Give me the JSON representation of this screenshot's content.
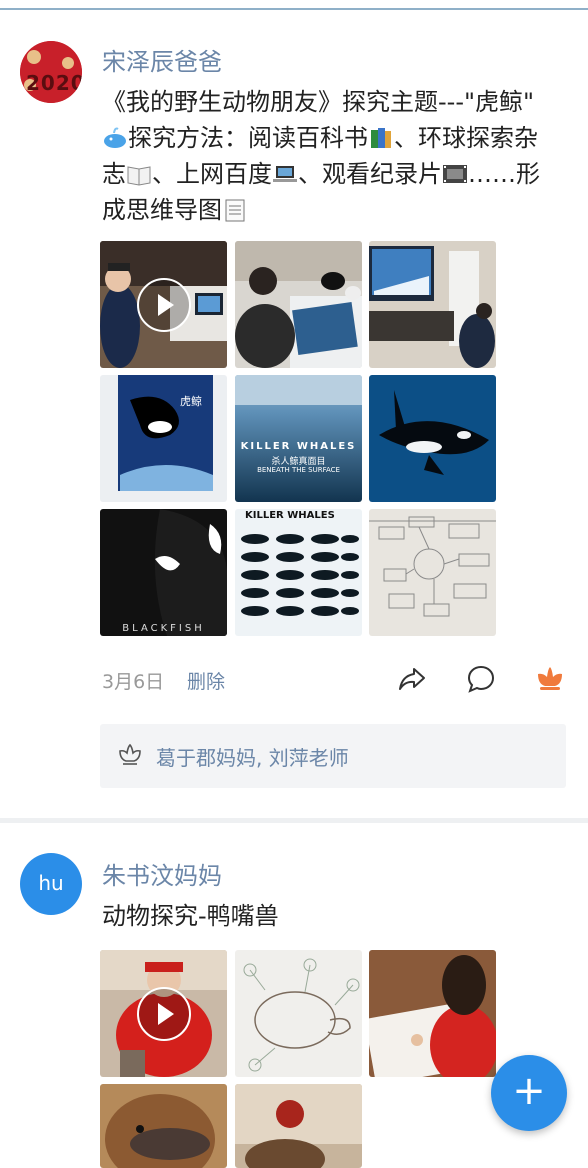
{
  "posts": [
    {
      "author": "宋泽辰爸爸",
      "avatar_text": "2020",
      "text_parts": [
        "《我的野生动物朋友》探究主题---\"虎鲸\"",
        "探究方法：阅读百科书",
        "、环球探索杂志",
        "、上网百度",
        "、观看纪录片",
        "……形成思维导图"
      ],
      "emoji_icons": [
        "whale-emoji-icon",
        "books-emoji-icon",
        "open-book-emoji-icon",
        "laptop-emoji-icon",
        "film-frames-emoji-icon",
        "notepad-emoji-icon"
      ],
      "thumbnails": [
        {
          "label": "video-boy-watching",
          "has_play": true
        },
        {
          "label": "boy-reading",
          "has_play": false
        },
        {
          "label": "tv-orca",
          "has_play": false
        },
        {
          "label": "book-cover-orca",
          "has_play": false,
          "title": "虎鲸"
        },
        {
          "label": "documentary-killer-whales",
          "has_play": false,
          "title": "KILLER WHALES",
          "subtitle": "杀人鲸真面目",
          "subtitle2": "BENEATH THE SURFACE"
        },
        {
          "label": "orca-underwater",
          "has_play": false
        },
        {
          "label": "blackfish-poster",
          "has_play": false,
          "title": "BLACKFISH"
        },
        {
          "label": "killer-whales-chart",
          "has_play": false,
          "title": "KILLER WHALES"
        },
        {
          "label": "mind-map-drawing",
          "has_play": false
        }
      ],
      "date": "3月6日",
      "delete_label": "删除",
      "likes": "葛于郡妈妈, 刘萍老师"
    },
    {
      "author": "朱书汶妈妈",
      "avatar_text": "hu",
      "text": "动物探究-鸭嘴兽",
      "thumbnails": [
        {
          "label": "video-girl",
          "has_play": true
        },
        {
          "label": "platypus-drawing",
          "has_play": false
        },
        {
          "label": "girl-drawing",
          "has_play": false
        },
        {
          "label": "platypus-photo",
          "has_play": false
        },
        {
          "label": "platypus-bird",
          "has_play": false
        }
      ]
    }
  ],
  "fab": {
    "label": "+"
  },
  "colors": {
    "accent": "#2b8ee8",
    "name": "#6b86a8",
    "like": "#f07a3c"
  }
}
